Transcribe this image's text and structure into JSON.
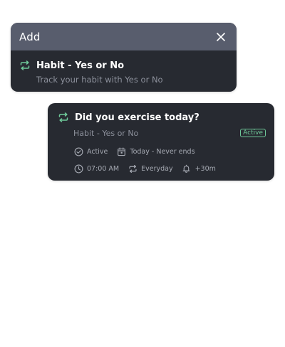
{
  "add_dialog": {
    "title": "Add",
    "option": {
      "title": "Habit - Yes or No",
      "description": "Track your habit with Yes or No"
    }
  },
  "habit_card": {
    "title": "Did you exercise today?",
    "type_label": "Habit - Yes or No",
    "status_badge": "Active",
    "status_text": "Active",
    "schedule_text": "Today - Never ends",
    "time_text": "07:00 AM",
    "frequency_text": "Everyday",
    "reminder_text": "+30m"
  },
  "colors": {
    "accent_green": "#6fc99a",
    "card_bg": "#272a31",
    "header_bg": "#585d6d"
  }
}
